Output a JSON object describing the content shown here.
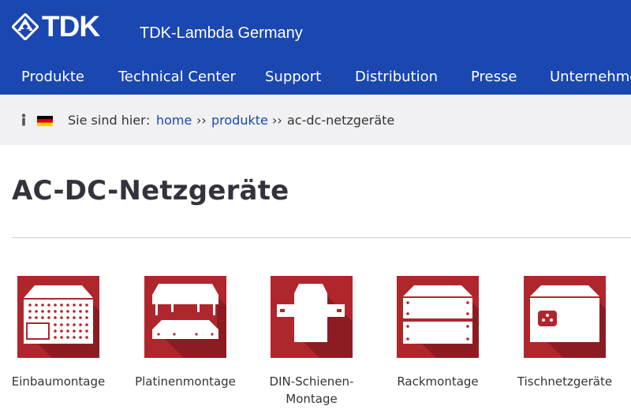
{
  "brand": {
    "logo_text": "TDK",
    "site_name": "TDK-Lambda Germany",
    "color": "#1a47b0"
  },
  "nav": {
    "items": [
      {
        "label": "Produkte"
      },
      {
        "label": "Technical Center"
      },
      {
        "label": "Support"
      },
      {
        "label": "Distribution"
      },
      {
        "label": "Presse"
      },
      {
        "label": "Unternehmen"
      }
    ]
  },
  "breadcrumb": {
    "prefix": "Sie sind hier",
    "separator": ":",
    "crumb_sep": "››",
    "links": [
      "home",
      "produkte"
    ],
    "current": "ac-dc-netzgeräte"
  },
  "page": {
    "title": "AC-DC-Netzgeräte"
  },
  "categories": [
    {
      "label": "Einbaumontage",
      "icon": "enclosed-psu-icon"
    },
    {
      "label": "Platinenmontage",
      "icon": "pcb-mount-psu-icon"
    },
    {
      "label": "DIN-Schienen-Montage",
      "icon": "din-rail-psu-icon"
    },
    {
      "label": "Rackmontage",
      "icon": "rack-mount-psu-icon"
    },
    {
      "label": "Tischnetzgeräte",
      "icon": "benchtop-psu-icon"
    }
  ],
  "colors": {
    "tile_red": "#b0262d",
    "tile_shadow": "#8c1c22",
    "link": "#1a47b0",
    "breadcrumb_bg": "#f1f1f3"
  }
}
